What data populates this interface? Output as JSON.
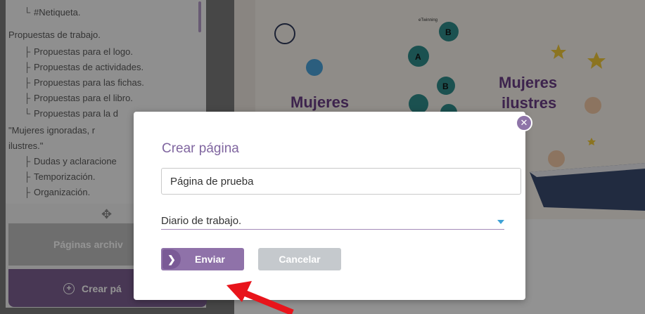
{
  "sidebar": {
    "tree": [
      {
        "branch": "└",
        "label": "#Netiqueta.",
        "indent": 1
      },
      {
        "branch": "",
        "label": "Propuestas de trabajo.",
        "indent": 0
      },
      {
        "branch": "├",
        "label": "Propuestas para el logo.",
        "indent": 1
      },
      {
        "branch": "├",
        "label": "Propuestas de actividades.",
        "indent": 1
      },
      {
        "branch": "├",
        "label": "Propuestas para las fichas.",
        "indent": 1
      },
      {
        "branch": "├",
        "label": "Propuestas para el libro.",
        "indent": 1
      },
      {
        "branch": "└",
        "label": "Propuestas para la d",
        "indent": 1
      },
      {
        "branch": "",
        "label": "\"Mujeres ignoradas, r",
        "indent": 0
      },
      {
        "branch": "",
        "label": "ilustres.\"",
        "indent": 0
      },
      {
        "branch": "├",
        "label": "Dudas y aclaracione",
        "indent": 1
      },
      {
        "branch": "├",
        "label": "Temporización.",
        "indent": 1
      },
      {
        "branch": "├",
        "label": "Organización.",
        "indent": 1
      }
    ],
    "archived_label": "Páginas archiv",
    "create_label": "Crear pá"
  },
  "banner": {
    "word_left": "Mujeres",
    "word_right_1": "Mujeres",
    "word_right_2": "ilustres",
    "logo_text": "eTwinning"
  },
  "modal": {
    "title": "Crear página",
    "name_value": "Página de prueba",
    "select_value": "Diario de trabajo.",
    "send_label": "Enviar",
    "cancel_label": "Cancelar",
    "close_symbol": "✕"
  },
  "colors": {
    "accent": "#8f72a9",
    "title": "#8066a0",
    "cancel": "#c5c9cd",
    "arrow": "#e8141b"
  }
}
